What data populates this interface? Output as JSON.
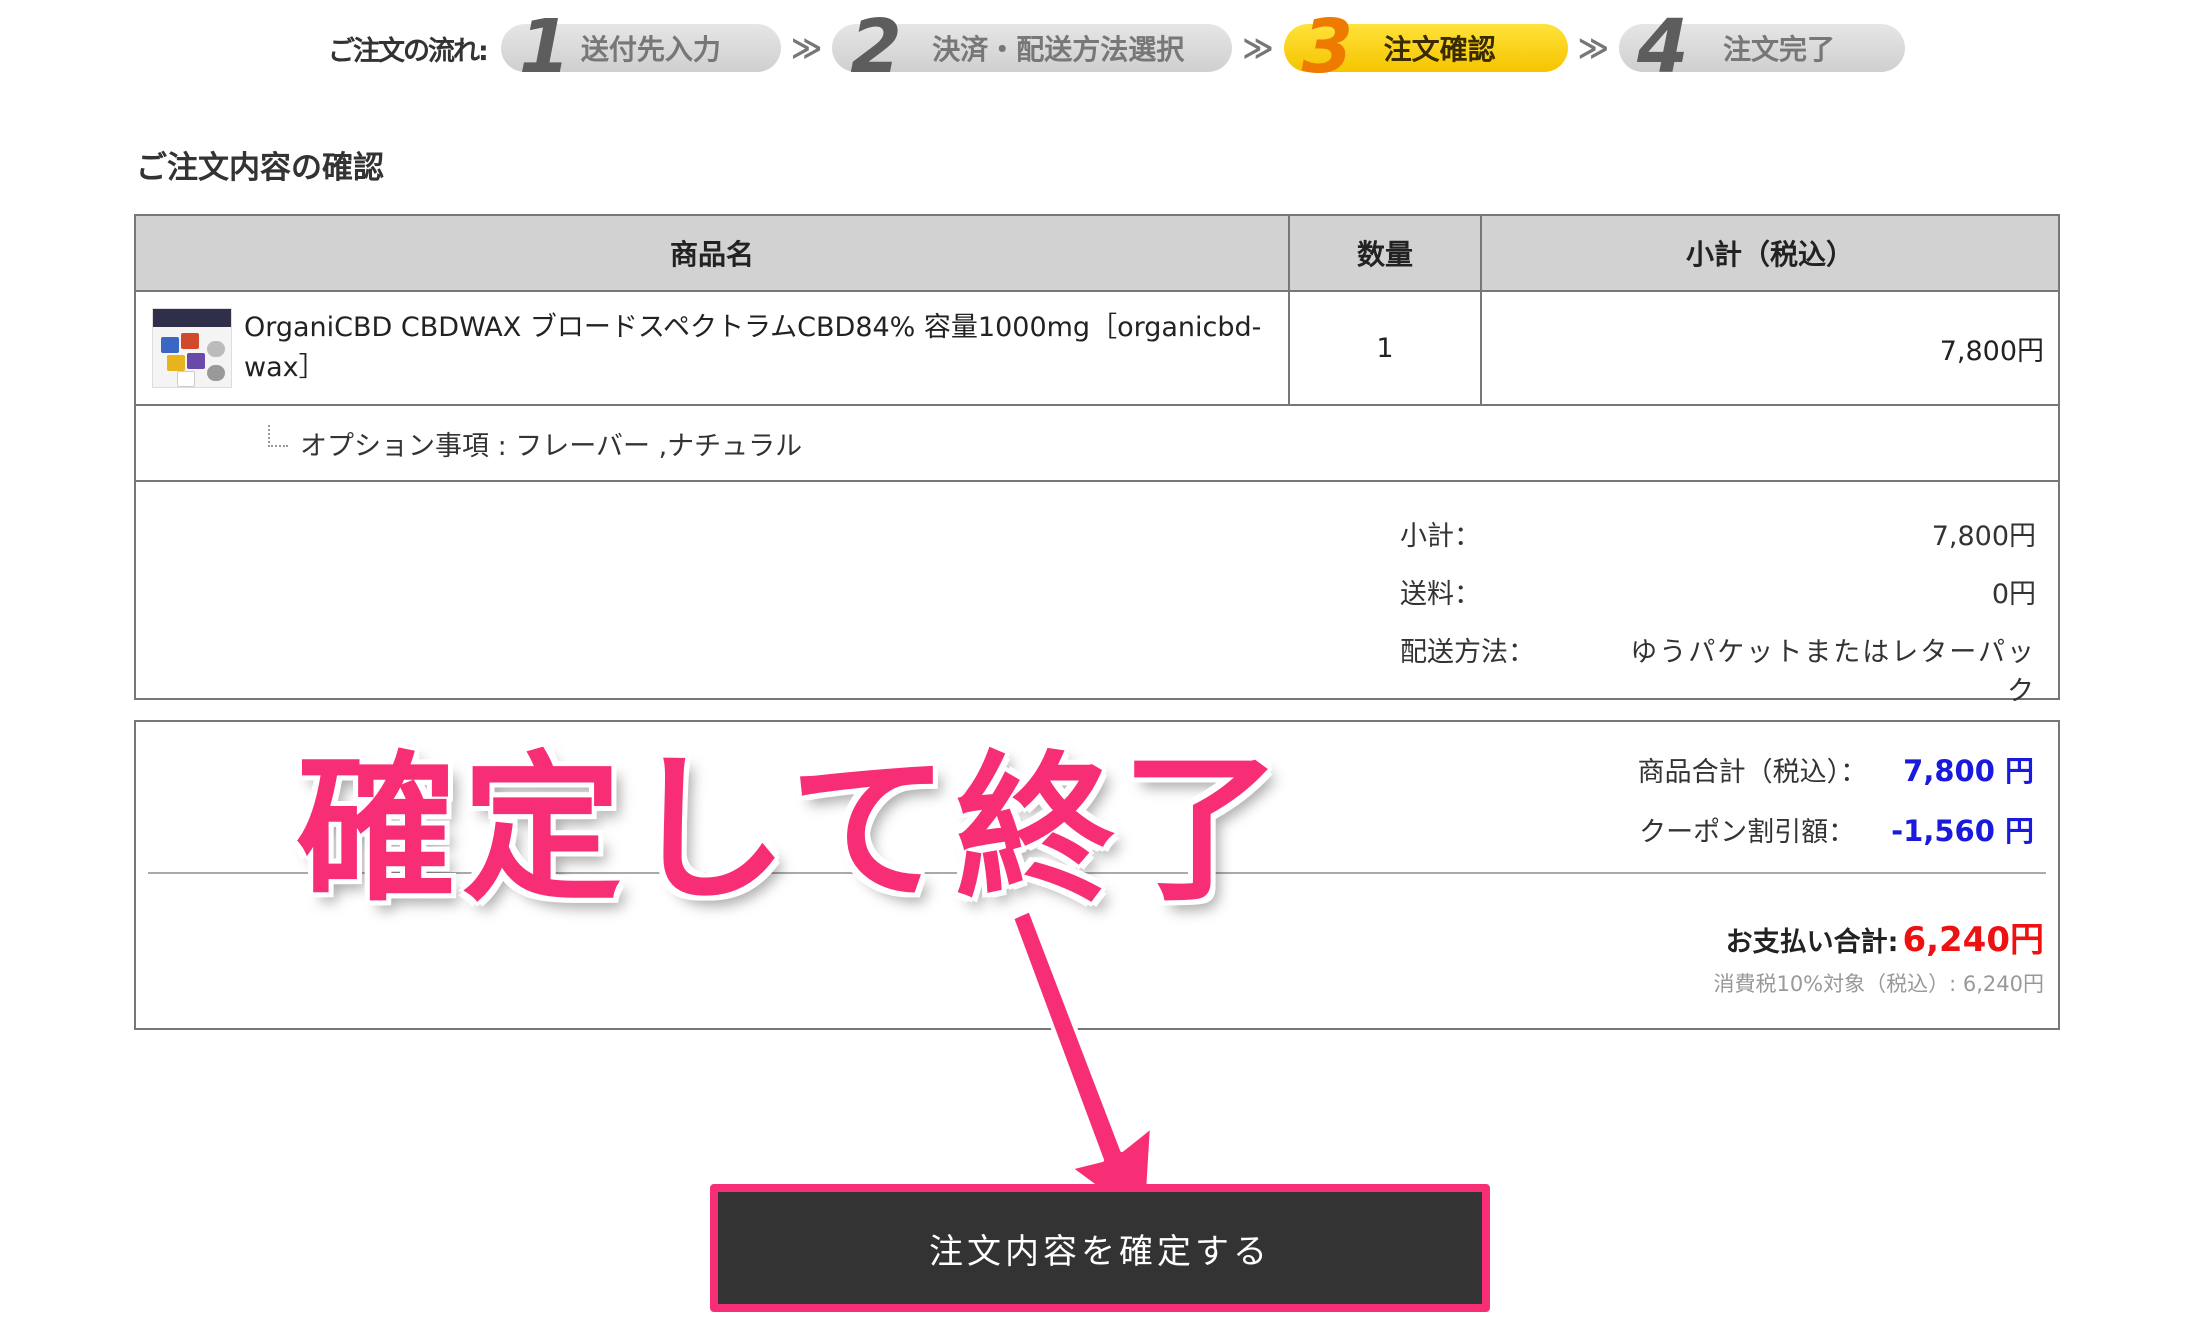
{
  "flow": {
    "label": "ご注文の流れ:",
    "separator": "≫",
    "steps": [
      {
        "num": "1",
        "label": "送付先入力",
        "active": false
      },
      {
        "num": "2",
        "label": "決済・配送方法選択",
        "active": false
      },
      {
        "num": "3",
        "label": "注文確認",
        "active": true
      },
      {
        "num": "4",
        "label": "注文完了",
        "active": false
      }
    ]
  },
  "title": "ご注文内容の確認",
  "table": {
    "headers": [
      "商品名",
      "数量",
      "小計（税込）"
    ],
    "item": {
      "name": "OrganiCBD CBDWAX ブロードスペクトラムCBD84% 容量1000mg［organicbd-wax］",
      "quantity": "1",
      "subtotal": "7,800円"
    },
    "option": "オプション事項 : フレーバー ,ナチュラル"
  },
  "summary": {
    "subtotal_label": "小計：",
    "subtotal_value": "7,800円",
    "shipping_label": "送料：",
    "shipping_value": "0円",
    "method_label": "配送方法：",
    "method_value": "ゆうパケットまたはレターパック"
  },
  "totals": {
    "goods_label": "商品合計（税込）：",
    "goods_value": "7,800 円",
    "coupon_label": "クーポン割引額：",
    "coupon_value": "-1,560 円",
    "payment_label": "お支払い合計:",
    "payment_value": "6,240円",
    "tax_note": "消費税10%対象（税込）: 6,240円"
  },
  "annotation": "確定して終了",
  "confirm_button": "注文内容を確定する",
  "colors": {
    "accent_pink": "#f72e76",
    "active_step": "#f5c400",
    "total_red": "#ee1111",
    "amount_blue": "#1a1adf",
    "button_dark": "#333333"
  }
}
